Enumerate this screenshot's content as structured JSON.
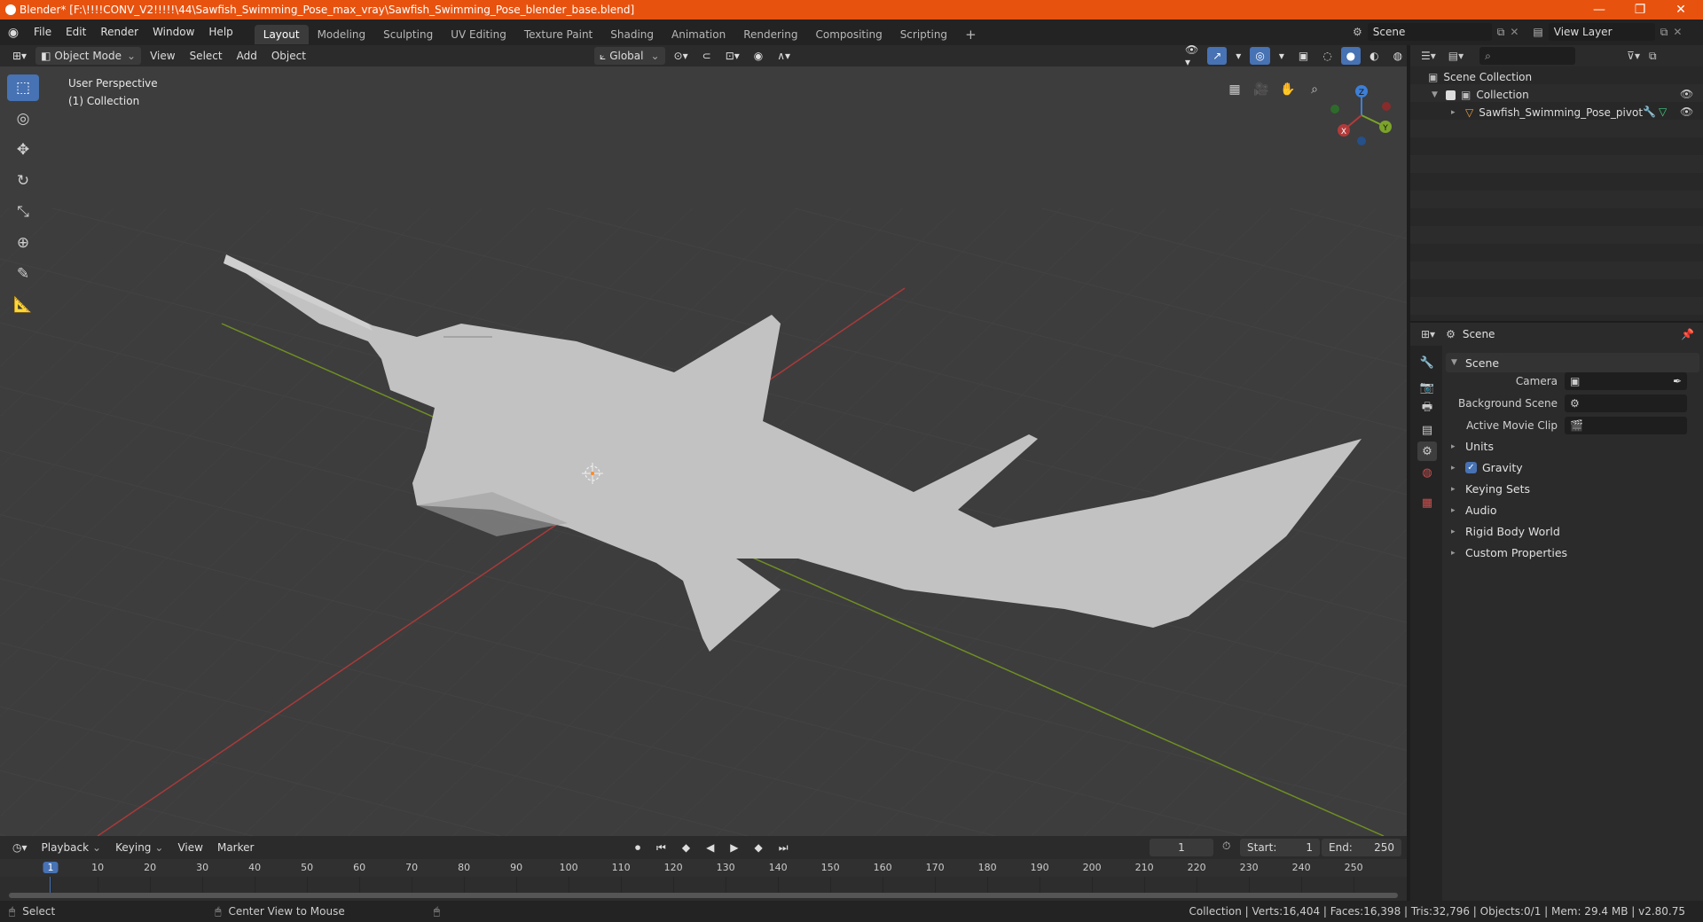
{
  "window": {
    "title": "Blender* [F:\\!!!!CONV_V2!!!!!\\44\\Sawfish_Swimming_Pose_max_vray\\Sawfish_Swimming_Pose_blender_base.blend]",
    "minimize": "—",
    "maximize": "❐",
    "close": "✕"
  },
  "menu": [
    "File",
    "Edit",
    "Render",
    "Window",
    "Help"
  ],
  "workspaces": [
    "Layout",
    "Modeling",
    "Sculpting",
    "UV Editing",
    "Texture Paint",
    "Shading",
    "Animation",
    "Rendering",
    "Compositing",
    "Scripting"
  ],
  "active_workspace": "Layout",
  "add_workspace": "+",
  "scene_selector": {
    "value": "Scene"
  },
  "view_layer_selector": {
    "value": "View Layer"
  },
  "viewport_header": {
    "mode": "Object Mode",
    "menus": [
      "View",
      "Select",
      "Add",
      "Object"
    ],
    "transform_orientation": "Global"
  },
  "viewport": {
    "perspective": "User Perspective",
    "collection": "(1) Collection",
    "gizmo_axes": {
      "x": "X",
      "y": "Y",
      "z": "Z"
    }
  },
  "outliner": {
    "items": [
      {
        "label": "Scene Collection"
      },
      {
        "label": "Collection"
      },
      {
        "label": "Sawfish_Swimming_Pose_pivot"
      }
    ]
  },
  "properties": {
    "context": "Scene",
    "panel_title": "Scene",
    "fields": [
      {
        "label": "Camera"
      },
      {
        "label": "Background Scene"
      },
      {
        "label": "Active Movie Clip"
      }
    ],
    "sections": [
      "Units",
      "Gravity",
      "Keying Sets",
      "Audio",
      "Rigid Body World",
      "Custom Properties"
    ],
    "gravity_checked": true
  },
  "timeline": {
    "menus": [
      "Playback",
      "Keying",
      "View",
      "Marker"
    ],
    "current_frame": "1",
    "start_label": "Start:",
    "start": "1",
    "end_label": "End:",
    "end": "250",
    "ticks": [
      "1",
      "10",
      "20",
      "30",
      "40",
      "50",
      "60",
      "70",
      "80",
      "90",
      "100",
      "110",
      "120",
      "130",
      "140",
      "150",
      "160",
      "170",
      "180",
      "190",
      "200",
      "210",
      "220",
      "230",
      "240",
      "250"
    ]
  },
  "statusbar": {
    "left": "Select",
    "middle": "Center View to Mouse",
    "right": "Collection | Verts:16,404 | Faces:16,398 | Tris:32,796 | Objects:0/1 | Mem: 29.4 MB | v2.80.75"
  },
  "colors": {
    "titlebar": "#e8520f",
    "accent": "#4772b3",
    "x_axis": "#b33a3a",
    "y_axis": "#7ba32a",
    "z_axis": "#3d7fd6"
  }
}
